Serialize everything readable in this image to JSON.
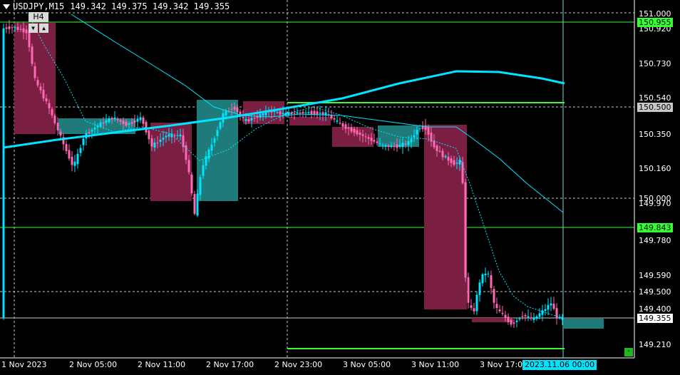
{
  "header": {
    "symbol_timeframe": "USDJPY,M15",
    "ohlc": "149.342 149.375 149.342 149.355",
    "htf_label": "H4",
    "scroll_left_glyph": "▼",
    "scroll_right_glyph": "▲"
  },
  "price_axis": {
    "ticks": [
      "150.920",
      "150.730",
      "150.540",
      "150.350",
      "150.160",
      "149.970",
      "149.780",
      "149.590",
      "149.400",
      "149.210"
    ],
    "levels": [
      {
        "label": "151.000",
        "color": "#ffffff",
        "bg": "#000000"
      },
      {
        "label": "150.955",
        "color": "#000000",
        "bg": "#33ff33"
      },
      {
        "label": "150.500",
        "color": "#000000",
        "bg": "#c8c8c8"
      },
      {
        "label": "150.000",
        "color": "#ffffff",
        "bg": "#000000"
      },
      {
        "label": "149.843",
        "color": "#000000",
        "bg": "#33ff33"
      },
      {
        "label": "149.500",
        "color": "#ffffff",
        "bg": "#000000"
      },
      {
        "label": "149.355",
        "color": "#000000",
        "bg": "#ffffff"
      }
    ]
  },
  "time_axis": {
    "labels": [
      "1 Nov 2023",
      "2 Nov 05:00",
      "2 Nov 11:00",
      "2 Nov 17:00",
      "2 Nov 23:00",
      "3 Nov 05:00",
      "3 Nov 11:00",
      "3 Nov 17:00"
    ],
    "crosshair_time": "2023.11.06 00:00"
  },
  "minimize_glyph": "-",
  "chart_data": {
    "type": "candlestick",
    "symbol": "USDJPY",
    "timeframe": "M15",
    "current_price": 149.355,
    "y_range": [
      149.12,
      151.06
    ],
    "colors": {
      "bull": "#00e5ff",
      "bear": "#ff69b4",
      "htf_bull": "#1f7a7a",
      "htf_bear": "#7a1f42",
      "ma_fast": "#00e5ff",
      "level_green": "#33ff33"
    },
    "htf_boxes": [
      {
        "open": 150.95,
        "close": 150.36,
        "dir": "bear"
      },
      {
        "open": 150.38,
        "close": 150.47,
        "dir": "bull"
      },
      {
        "open": 150.44,
        "close": 150.01,
        "dir": "bear"
      },
      {
        "open": 150.01,
        "close": 150.52,
        "dir": "bull"
      },
      {
        "open": 150.52,
        "close": 150.4,
        "dir": "bear"
      },
      {
        "open": 150.43,
        "close": 150.29,
        "dir": "bear"
      },
      {
        "open": 150.28,
        "close": 150.41,
        "dir": "bull"
      },
      {
        "open": 150.41,
        "close": 149.44,
        "dir": "bear"
      },
      {
        "open": 149.34,
        "close": 149.34,
        "dir": "bear"
      },
      {
        "open": 149.33,
        "close": 149.31,
        "dir": "bull"
      }
    ],
    "key_levels": [
      151.0,
      150.955,
      150.5,
      150.0,
      149.843,
      149.5,
      149.355
    ],
    "trend_levels": [
      150.52,
      149.218
    ]
  }
}
